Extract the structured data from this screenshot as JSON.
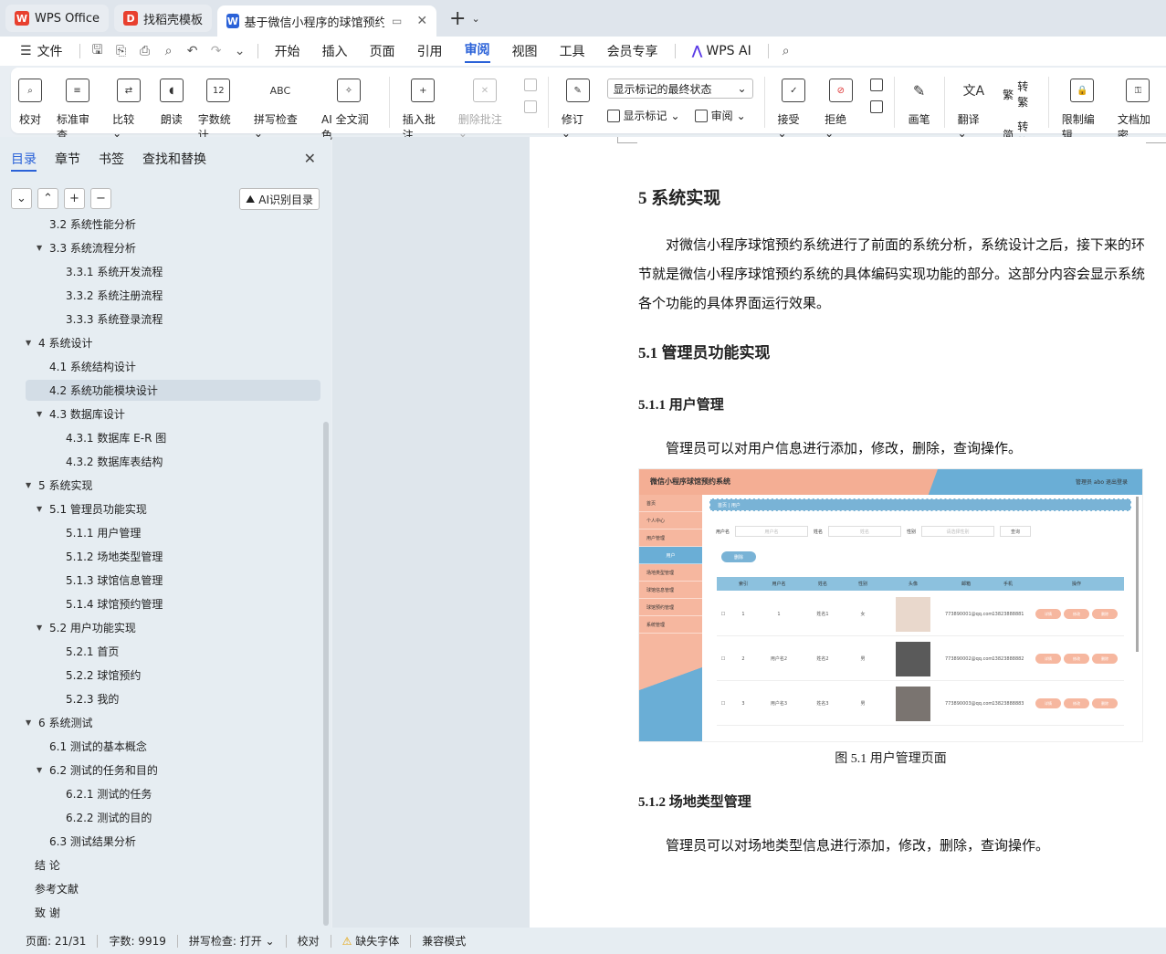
{
  "tabs": [
    {
      "label": "WPS Office",
      "icon": "wps-logo",
      "color": "#e8402f"
    },
    {
      "label": "找稻壳模板",
      "icon": "docer-logo",
      "color": "#e8402f"
    },
    {
      "label": "基于微信小程序的球馆预约管理",
      "icon": "word-logo",
      "color": "#2b62d8",
      "active": true
    }
  ],
  "menu": {
    "file": "文件",
    "items": [
      "开始",
      "插入",
      "页面",
      "引用",
      "审阅",
      "视图",
      "工具",
      "会员专享"
    ],
    "active": "审阅",
    "wps_ai": "WPS AI"
  },
  "ribbon": {
    "proofread": "校对",
    "standard_review": "标准审查",
    "compare": "比较",
    "read_aloud": "朗读",
    "word_count": "字数统计",
    "spell_check": "拼写检查",
    "ai_polish": "AI 全文润色",
    "insert_comment": "插入批注",
    "delete_comment": "删除批注",
    "revise": "修订",
    "markup_select": "显示标记的最终状态",
    "show_markup": "显示标记",
    "review": "审阅",
    "accept": "接受",
    "reject": "拒绝",
    "pen": "画笔",
    "translate": "翻译",
    "to_traditional": "转繁",
    "to_simplified": "转简",
    "restrict_edit": "限制编辑",
    "doc_encrypt": "文档加密"
  },
  "nav": {
    "tabs": [
      "目录",
      "章节",
      "书签",
      "查找和替换"
    ],
    "active_tab": "目录",
    "ai_toc": "AI识别目录",
    "toc": [
      {
        "text": "3.2 系统性能分析",
        "level": 2,
        "arrow": false
      },
      {
        "text": "3.3  系统流程分析",
        "level": 2,
        "arrow": true
      },
      {
        "text": "3.3.1  系统开发流程",
        "level": 3,
        "arrow": false
      },
      {
        "text": "3.3.2  系统注册流程",
        "level": 3,
        "arrow": false
      },
      {
        "text": "3.3.3  系统登录流程",
        "level": 3,
        "arrow": false
      },
      {
        "text": "4  系统设计",
        "level": 1,
        "arrow": true
      },
      {
        "text": "4.1  系统结构设计",
        "level": 2,
        "arrow": false
      },
      {
        "text": "4.2 系统功能模块设计",
        "level": 2,
        "arrow": false,
        "selected": true
      },
      {
        "text": "4.3 数据库设计",
        "level": 2,
        "arrow": true
      },
      {
        "text": "4.3.1 数据库 E-R 图",
        "level": 3,
        "arrow": false
      },
      {
        "text": "4.3.2  数据库表结构",
        "level": 3,
        "arrow": false
      },
      {
        "text": "5  系统实现",
        "level": 1,
        "arrow": true
      },
      {
        "text": "5.1  管理员功能实现",
        "level": 2,
        "arrow": true
      },
      {
        "text": "5.1.1  用户管理",
        "level": 3,
        "arrow": false
      },
      {
        "text": "5.1.2  场地类型管理",
        "level": 3,
        "arrow": false
      },
      {
        "text": "5.1.3  球馆信息管理",
        "level": 3,
        "arrow": false
      },
      {
        "text": "5.1.4  球馆预约管理",
        "level": 3,
        "arrow": false
      },
      {
        "text": "5.2  用户功能实现",
        "level": 2,
        "arrow": true
      },
      {
        "text": "5.2.1  首页",
        "level": 3,
        "arrow": false
      },
      {
        "text": "5.2.2  球馆预约",
        "level": 3,
        "arrow": false
      },
      {
        "text": "5.2.3  我的",
        "level": 3,
        "arrow": false
      },
      {
        "text": "6 系统测试",
        "level": 1,
        "arrow": true
      },
      {
        "text": "6.1  测试的基本概念",
        "level": 2,
        "arrow": false
      },
      {
        "text": "6.2  测试的任务和目的",
        "level": 2,
        "arrow": true
      },
      {
        "text": "6.2.1 测试的任务",
        "level": 3,
        "arrow": false
      },
      {
        "text": "6.2.2 测试的目的",
        "level": 3,
        "arrow": false
      },
      {
        "text": "6.3  测试结果分析",
        "level": 2,
        "arrow": false
      },
      {
        "text": "结    论",
        "level": 0,
        "arrow": false
      },
      {
        "text": "参考文献",
        "level": 0,
        "arrow": false
      },
      {
        "text": "致    谢",
        "level": 0,
        "arrow": false
      }
    ]
  },
  "doc": {
    "h1": "5  系统实现",
    "p1": "对微信小程序球馆预约系统进行了前面的系统分析，系统设计之后，接下来的环节就是微信小程序球馆预约系统的具体编码实现功能的部分。这部分内容会显示系统各个功能的具体界面运行效果。",
    "h2": "5.1  管理员功能实现",
    "h3a": "5.1.1  用户管理",
    "p2": "管理员可以对用户信息进行添加，修改，删除，查询操作。",
    "caption": "图 5.1  用户管理页面",
    "h3b": "5.1.2  场地类型管理",
    "p3": "管理员可以对场地类型信息进行添加，修改，删除，查询操作。"
  },
  "figure": {
    "title": "微信小程序球馆预约系统",
    "user": "管理员 abo    退出登录",
    "side": [
      "首页",
      "个人中心",
      "用户管理",
      "用户",
      "场地类型管理",
      "球馆信息管理",
      "球馆预约管理",
      "系统管理"
    ],
    "breadcrumb": "首页  |  用户",
    "search": {
      "user_label": "用户名",
      "user_ph": "用户名",
      "name_label": "姓名",
      "name_ph": "姓名",
      "gender_label": "性别",
      "gender_ph": "请选择性别",
      "btn": "查询"
    },
    "delete_btn": "删除",
    "columns": [
      "",
      "索引",
      "用户名",
      "姓名",
      "性别",
      "头像",
      "邮箱",
      "手机",
      "操作"
    ],
    "rows": [
      {
        "idx": "1",
        "user": "1",
        "name": "姓名1",
        "gender": "女",
        "email": "773890001@qq.com",
        "phone": "13823888881"
      },
      {
        "idx": "2",
        "user": "用户名2",
        "name": "姓名2",
        "gender": "男",
        "email": "773890002@qq.com",
        "phone": "13823888882"
      },
      {
        "idx": "3",
        "user": "用户名3",
        "name": "姓名3",
        "gender": "男",
        "email": "773890003@qq.com",
        "phone": "13823888883"
      }
    ],
    "ops": [
      "详情",
      "修改",
      "删除"
    ]
  },
  "status": {
    "page": "页面: 21/31",
    "words": "字数: 9919",
    "spell": "拼写检查: 打开",
    "proof": "校对",
    "missing_font": "缺失字体",
    "compat": "兼容模式"
  }
}
